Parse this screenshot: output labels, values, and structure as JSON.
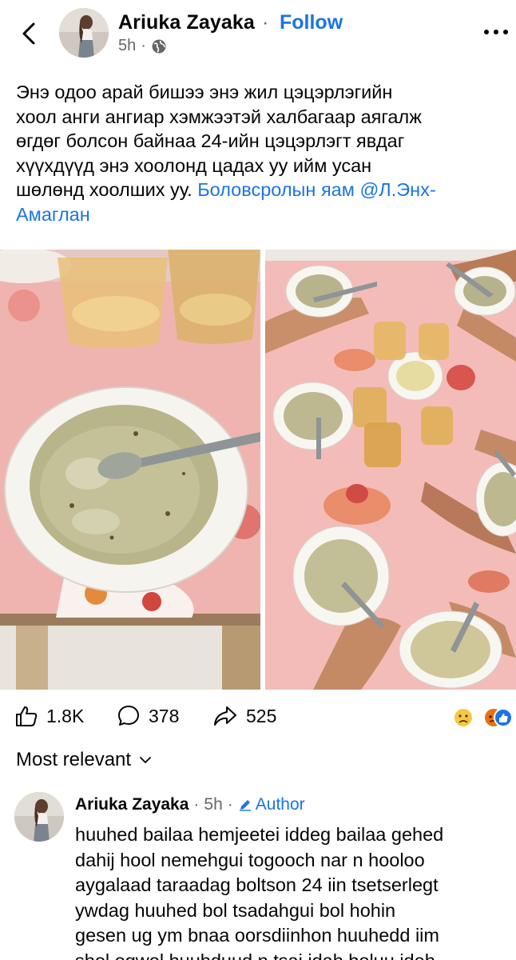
{
  "header": {
    "author": "Ariuka Zayaka",
    "separator": "·",
    "follow_label": "Follow",
    "time": "5h",
    "time_separator": "·"
  },
  "post": {
    "text_lines": [
      "Энэ одоо арай бишээ энэ жил цэцэрлэгийн",
      "хоол анги ангиар хэмжээтэй халбагаар аягалж",
      "өгдөг болсон байнаа 24-ийн цэцэрлэгт явдаг",
      "хүүхдүүд энэ хоолонд цадах уу ийм усан",
      "шөлөнд хоолших уу."
    ],
    "tag_1": "Боловсролын яам",
    "tag_2": "@Л.Энх-",
    "tag_3": "Амаглан"
  },
  "actions": {
    "likes": "1.8K",
    "comments": "378",
    "shares": "525"
  },
  "comments_sort": {
    "label": "Most relevant"
  },
  "comment": {
    "author": "Ariuka Zayaka",
    "separator": "·",
    "time": "5h",
    "separator_2": "·",
    "badge": "Author",
    "lines": [
      "huuhed bailaa hemjeetei iddeg bailaa gehed",
      "dahij hool nemehgui togooch nar n hooloo",
      "aygalaad taraadag boltson 24 iin tsetserlegt",
      "ywdag huuhed bol tsadahgui bol hohin",
      "gesen ug ym bnaa oorsdiinhon huuhedd iim",
      "shol ogwol huuhduud n tsai idah boluu ideh"
    ]
  },
  "colors": {
    "link": "#1b74e4",
    "meta": "#65676b",
    "tablecloth": "#f2b8b5"
  }
}
